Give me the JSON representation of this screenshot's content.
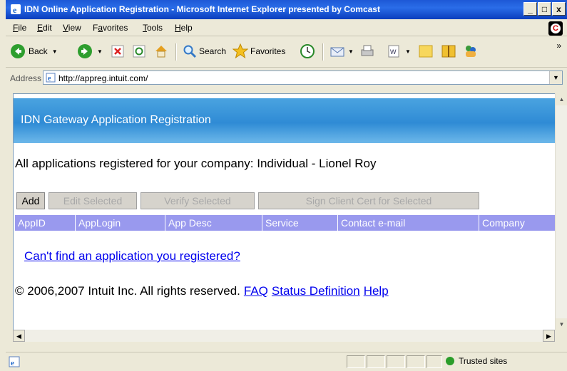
{
  "window": {
    "title": "IDN Online Application Registration - Microsoft Internet Explorer presented by Comcast",
    "controls": [
      "_",
      "□",
      "x"
    ]
  },
  "menu": {
    "items": [
      "File",
      "Edit",
      "View",
      "Favorites",
      "Tools",
      "Help"
    ],
    "accelerators": [
      "F",
      "E",
      "V",
      "a",
      "T",
      "H"
    ]
  },
  "toolbar": {
    "back_label": "Back",
    "search_label": "Search",
    "favorites_label": "Favorites",
    "overflow": "»"
  },
  "address": {
    "label": "Address",
    "url": "http://appreg.intuit.com/"
  },
  "page": {
    "header_title": "IDN Gateway Application Registration",
    "heading": "All applications registered for your company: Individual - Lionel Roy",
    "buttons": {
      "add": "Add",
      "edit_selected": "Edit Selected",
      "verify_selected": "Verify Selected",
      "sign_cert": "Sign Client Cert for Selected"
    },
    "table": {
      "columns": [
        "AppID",
        "AppLogin",
        "App Desc",
        "Service",
        "Contact e-mail",
        "Company"
      ]
    },
    "cant_find_link": "Can't find an application you registered?",
    "footer": {
      "copyright": "© 2006,2007 Intuit Inc. All rights reserved.",
      "faq": "FAQ",
      "status_definition": "Status Definition",
      "help": "Help"
    }
  },
  "status": {
    "zone": "Trusted sites"
  },
  "colors": {
    "title_bar": "#1d58d6",
    "header_blue": "#2f8bd5",
    "table_header": "#9999ee",
    "link": "#0000ee"
  }
}
